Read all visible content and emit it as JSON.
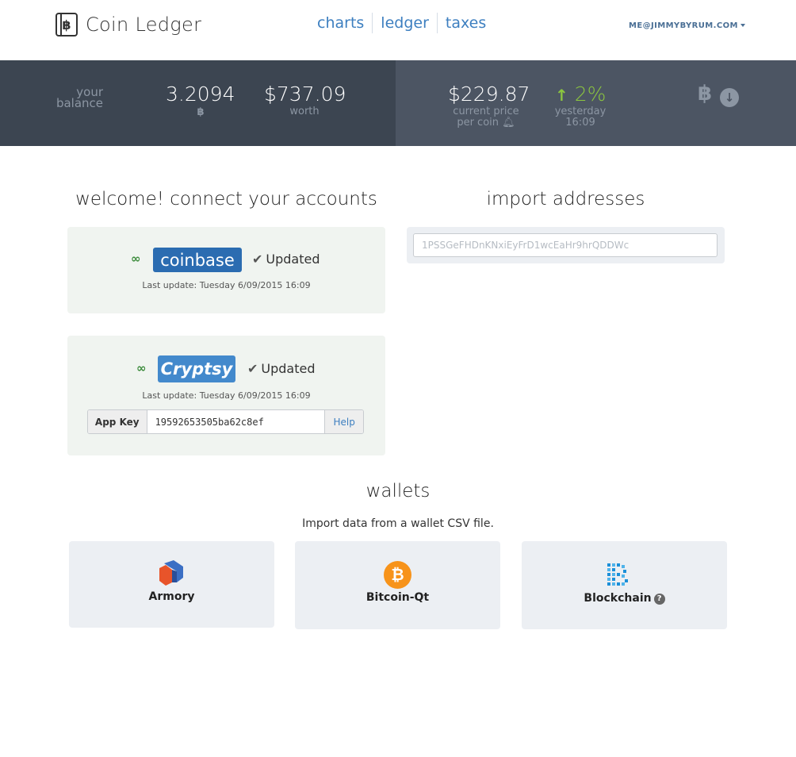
{
  "app": {
    "title": "Coin Ledger",
    "logo_glyph": "฿"
  },
  "nav": {
    "charts": "charts",
    "ledger": "ledger",
    "taxes": "taxes"
  },
  "user": {
    "email": "ME@JIMMYBYRUM.COM"
  },
  "stats": {
    "balance_label_1": "your",
    "balance_label_2": "balance",
    "balance_btc": "3.2094",
    "btc_glyph": "฿",
    "balance_usd": "$737.09",
    "worth_label": "worth",
    "price": "$229.87",
    "price_label_1": "current price",
    "price_label_2": "per coin",
    "change": "2%",
    "change_label_1": "yesterday",
    "change_label_2": "16:09"
  },
  "connect": {
    "title": "welcome! connect your accounts",
    "coinbase": {
      "brand": "coinbase",
      "status": "Updated",
      "last_update": "Last update: Tuesday 6/09/2015 16:09"
    },
    "cryptsy": {
      "brand": "Cryptsy",
      "status": "Updated",
      "last_update": "Last update: Tuesday 6/09/2015 16:09",
      "app_key_label": "App Key",
      "app_key_value": "19592653505ba62c8ef",
      "help_label": "Help"
    }
  },
  "import": {
    "title": "import addresses",
    "address_placeholder": "1PSSGeFHDnKNxiEyFrD1wcEaHr9hrQDDWc"
  },
  "wallets": {
    "title": "wallets",
    "subtitle": "Import data from a wallet CSV file.",
    "items": [
      {
        "label": "Armory"
      },
      {
        "label": "Bitcoin-Qt",
        "icon_glyph": "₿"
      },
      {
        "label": "Blockchain",
        "help_glyph": "?"
      }
    ]
  },
  "colors": {
    "accent": "#3d7fc0",
    "stats_left": "#3c4551",
    "stats_right": "#4c5563",
    "positive": "#8cc63f",
    "coinbase": "#2b6cb1",
    "cryptsy": "#4389cc",
    "bitcoin_orange": "#f7931a"
  }
}
